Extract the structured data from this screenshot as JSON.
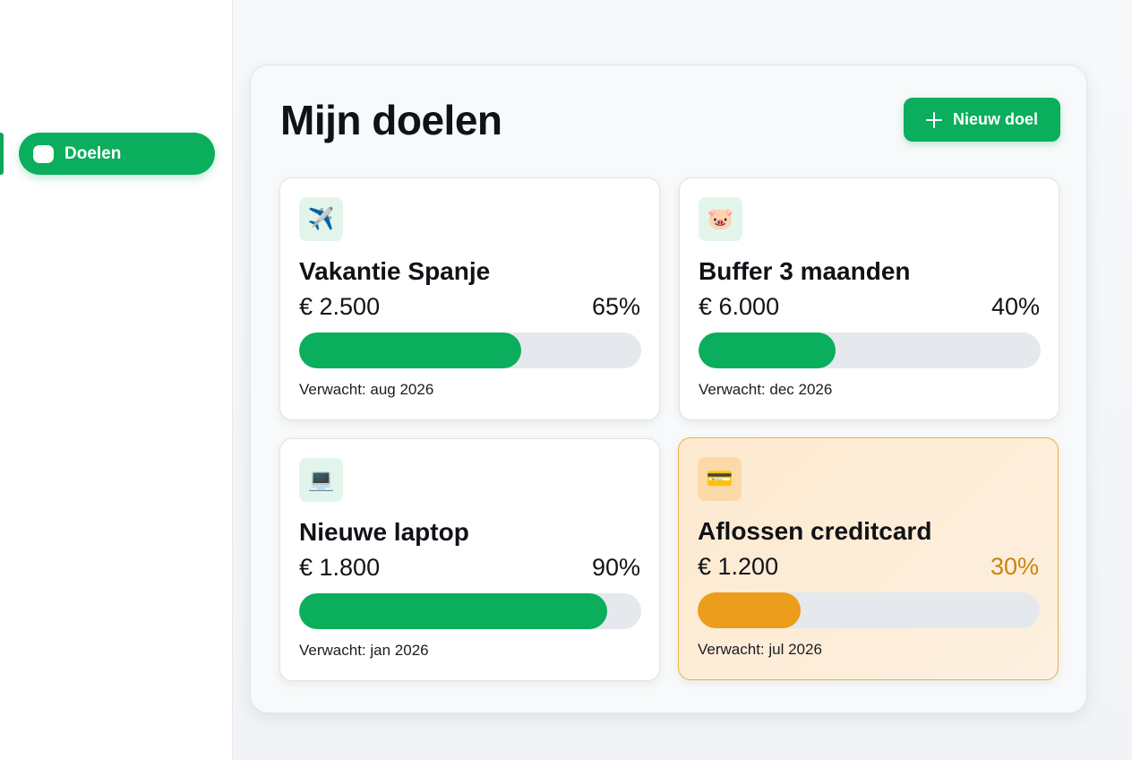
{
  "sidebar": {
    "items": [
      {
        "label": "Doelen",
        "icon": "goals-icon",
        "active": true
      }
    ]
  },
  "header": {
    "title": "Mijn doelen",
    "new_button_label": "Nieuw doel",
    "new_button_icon": "plus-icon"
  },
  "colors": {
    "accent": "#0aae5c",
    "warning": "#ec9d1c",
    "warning_text": "#c9860f"
  },
  "goals": [
    {
      "icon": "airplane-icon",
      "glyph": "✈️",
      "title": "Vakantie Spanje",
      "amount": "€ 2.500",
      "percent_label": "65%",
      "progress": 65,
      "expected": "Verwacht: aug 2026",
      "status": "normal"
    },
    {
      "icon": "piggy-bank-icon",
      "glyph": "🐷",
      "title": "Buffer 3 maanden",
      "amount": "€ 6.000",
      "percent_label": "40%",
      "progress": 40,
      "expected": "Verwacht: dec 2026",
      "status": "normal"
    },
    {
      "icon": "laptop-icon",
      "glyph": "💻",
      "title": "Nieuwe laptop",
      "amount": "€ 1.800",
      "percent_label": "90%",
      "progress": 90,
      "expected": "Verwacht: jan 2026",
      "status": "normal"
    },
    {
      "icon": "credit-card-icon",
      "glyph": "💳",
      "title": "Aflossen creditcard",
      "amount": "€ 1.200",
      "percent_label": "30%",
      "progress": 30,
      "expected": "Verwacht: jul 2026",
      "status": "warning"
    }
  ]
}
